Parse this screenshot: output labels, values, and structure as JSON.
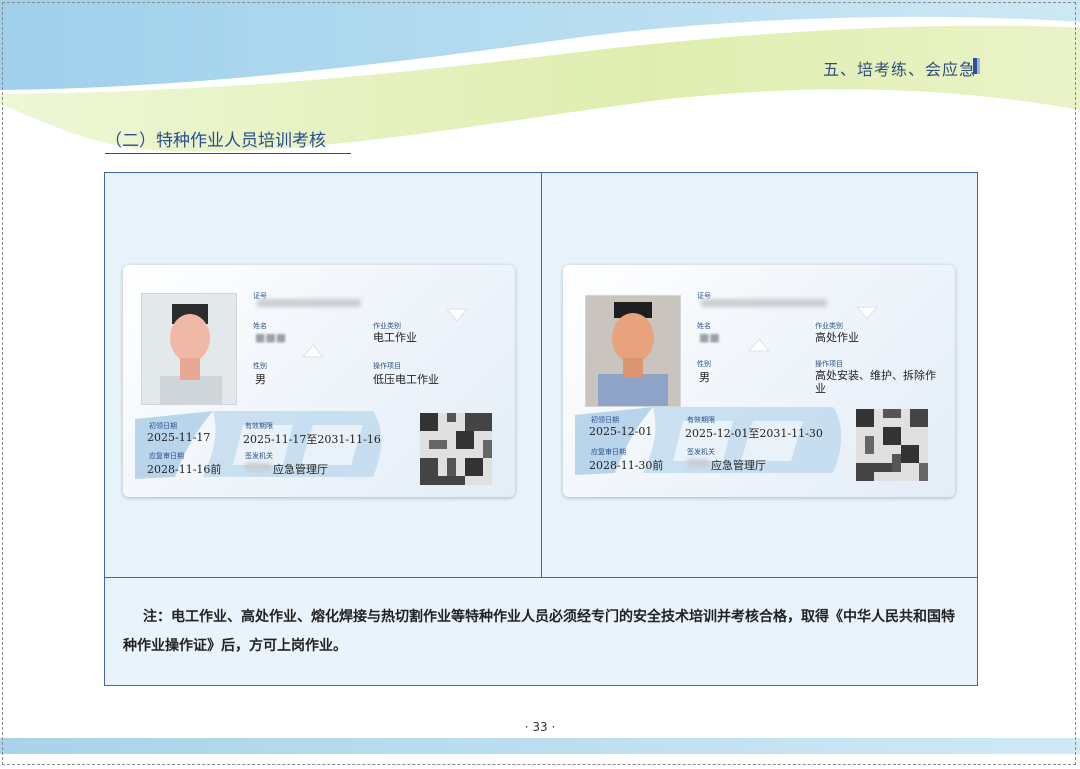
{
  "header": {
    "chapter_title": "五、培考练、会应急",
    "section_title": "（二）特种作业人员培训考核"
  },
  "cards": [
    {
      "labels": {
        "id": "证号",
        "name": "姓名",
        "gender": "性别",
        "category": "作业类别",
        "project": "操作项目",
        "first_date": "初领日期",
        "valid_period": "有效期限",
        "review_date": "应复审日期",
        "issuer": "签发机关"
      },
      "name_value": "■■■",
      "gender_value": "男",
      "category_value": "电工作业",
      "project_value": "低压电工作业",
      "first_date_value": "2025-11-17",
      "valid_period_value": "2025-11-17至2031-11-16",
      "review_date_value": "2028-11-16前",
      "issuer_value": "应急管理厅"
    },
    {
      "labels": {
        "id": "证号",
        "name": "姓名",
        "gender": "性别",
        "category": "作业类别",
        "project": "操作项目",
        "first_date": "初领日期",
        "valid_period": "有效期限",
        "review_date": "应复审日期",
        "issuer": "签发机关"
      },
      "name_value": "■■",
      "gender_value": "男",
      "category_value": "高处作业",
      "project_value": "高处安装、维护、拆除作业",
      "first_date_value": "2025-12-01",
      "valid_period_value": "2025-12-01至2031-11-30",
      "review_date_value": "2028-11-30前",
      "issuer_value": "应急管理厅"
    }
  ],
  "note": "注：电工作业、高处作业、熔化焊接与热切割作业等特种作业人员必须经专门的安全技术培训并考核合格，取得《中华人民共和国特种作业操作证》后，方可上岗作业。",
  "page_number": "· 33 ·",
  "colors": {
    "title_blue": "#2a4d8f",
    "panel_bg": "#e8f3fb",
    "panel_border": "#3f67a8",
    "band_blue": "#a8d3ea",
    "band_green": "#dfeeb0"
  }
}
